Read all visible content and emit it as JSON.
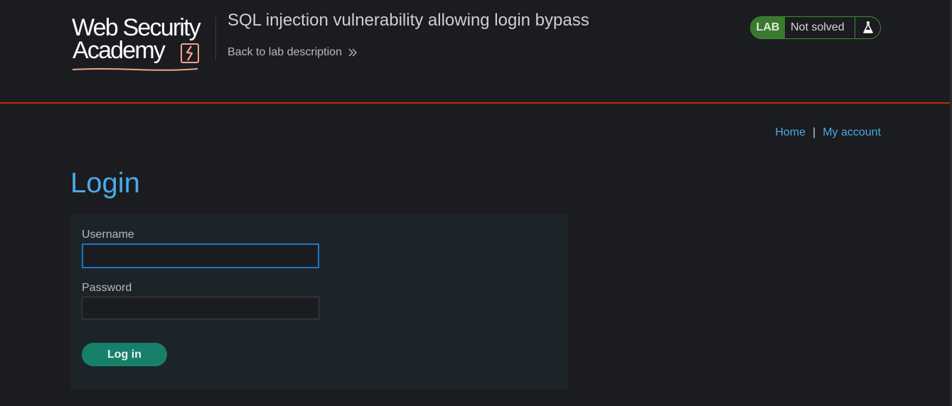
{
  "header": {
    "logo": {
      "line1": "Web Security",
      "line2": "Academy"
    },
    "lab_title": "SQL injection vulnerability allowing login bypass",
    "back_link_label": "Back to lab description",
    "lab_status": {
      "badge": "LAB",
      "state": "Not solved"
    }
  },
  "nav": {
    "home": "Home",
    "separator": "|",
    "my_account": "My account"
  },
  "page": {
    "title": "Login"
  },
  "form": {
    "username_label": "Username",
    "username_value": "",
    "password_label": "Password",
    "password_value": "",
    "submit_label": "Log in"
  },
  "colors": {
    "background": "#1b1c1f",
    "header_rule": "#b5300b",
    "link_blue": "#4ba8e3",
    "lab_green": "#3b7a2e",
    "button_teal": "#17806a",
    "panel": "#1c2429"
  },
  "icons": {
    "logo_mark": "lightning-bolt-icon",
    "back_chevron": "double-chevron-right-icon",
    "lab_flask": "flask-icon"
  }
}
